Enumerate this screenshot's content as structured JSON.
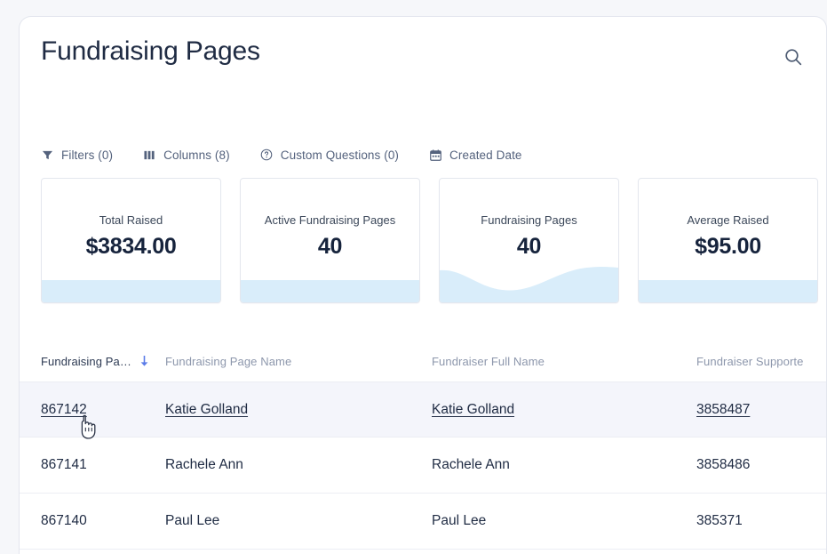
{
  "header": {
    "title": "Fundraising Pages",
    "search_icon": "search-icon"
  },
  "toolbar": {
    "items": [
      {
        "label": "Filters (0)",
        "icon": "filter-funnel-icon"
      },
      {
        "label": "Columns (8)",
        "icon": "columns-icon"
      },
      {
        "label": "Custom Questions (0)",
        "icon": "question-circle-icon"
      },
      {
        "label": "Created Date",
        "icon": "calendar-icon"
      }
    ]
  },
  "cards": [
    {
      "label": "Total Raised",
      "value": "$3834.00",
      "spark": "flat"
    },
    {
      "label": "Active Fundraising Pages",
      "value": "40",
      "spark": "flat"
    },
    {
      "label": "Fundraising Pages",
      "value": "40",
      "spark": "wave"
    },
    {
      "label": "Average Raised",
      "value": "$95.00",
      "spark": "flat"
    }
  ],
  "table": {
    "columns": [
      {
        "label": "Fundraising Pa…",
        "sorted": true,
        "sort_direction": "desc"
      },
      {
        "label": "Fundraising Page Name",
        "sorted": false
      },
      {
        "label": "Fundraiser Full Name",
        "sorted": false
      },
      {
        "label": "Fundraiser Supporte…",
        "sorted": false
      }
    ],
    "rows": [
      {
        "page_id": "867142",
        "page_name": "Katie Golland",
        "fundraiser_full_name": "Katie Golland",
        "fundraiser_supporter_id": "3858487",
        "hovered": true
      },
      {
        "page_id": "867141",
        "page_name": "Rachele Ann",
        "fundraiser_full_name": "Rachele Ann",
        "fundraiser_supporter_id": "3858486",
        "hovered": false
      },
      {
        "page_id": "867140",
        "page_name": "Paul Lee",
        "fundraiser_full_name": "Paul Lee",
        "fundraiser_supporter_id": "385371",
        "hovered": false
      }
    ]
  },
  "colors": {
    "accent_blue": "#5b7ce8",
    "spark_blue": "#d9edfa",
    "text_dark": "#16233c",
    "text_muted": "#8d97ac",
    "row_hover": "#f4f5fb"
  },
  "cursor": {
    "type": "pointing-hand-cursor"
  }
}
